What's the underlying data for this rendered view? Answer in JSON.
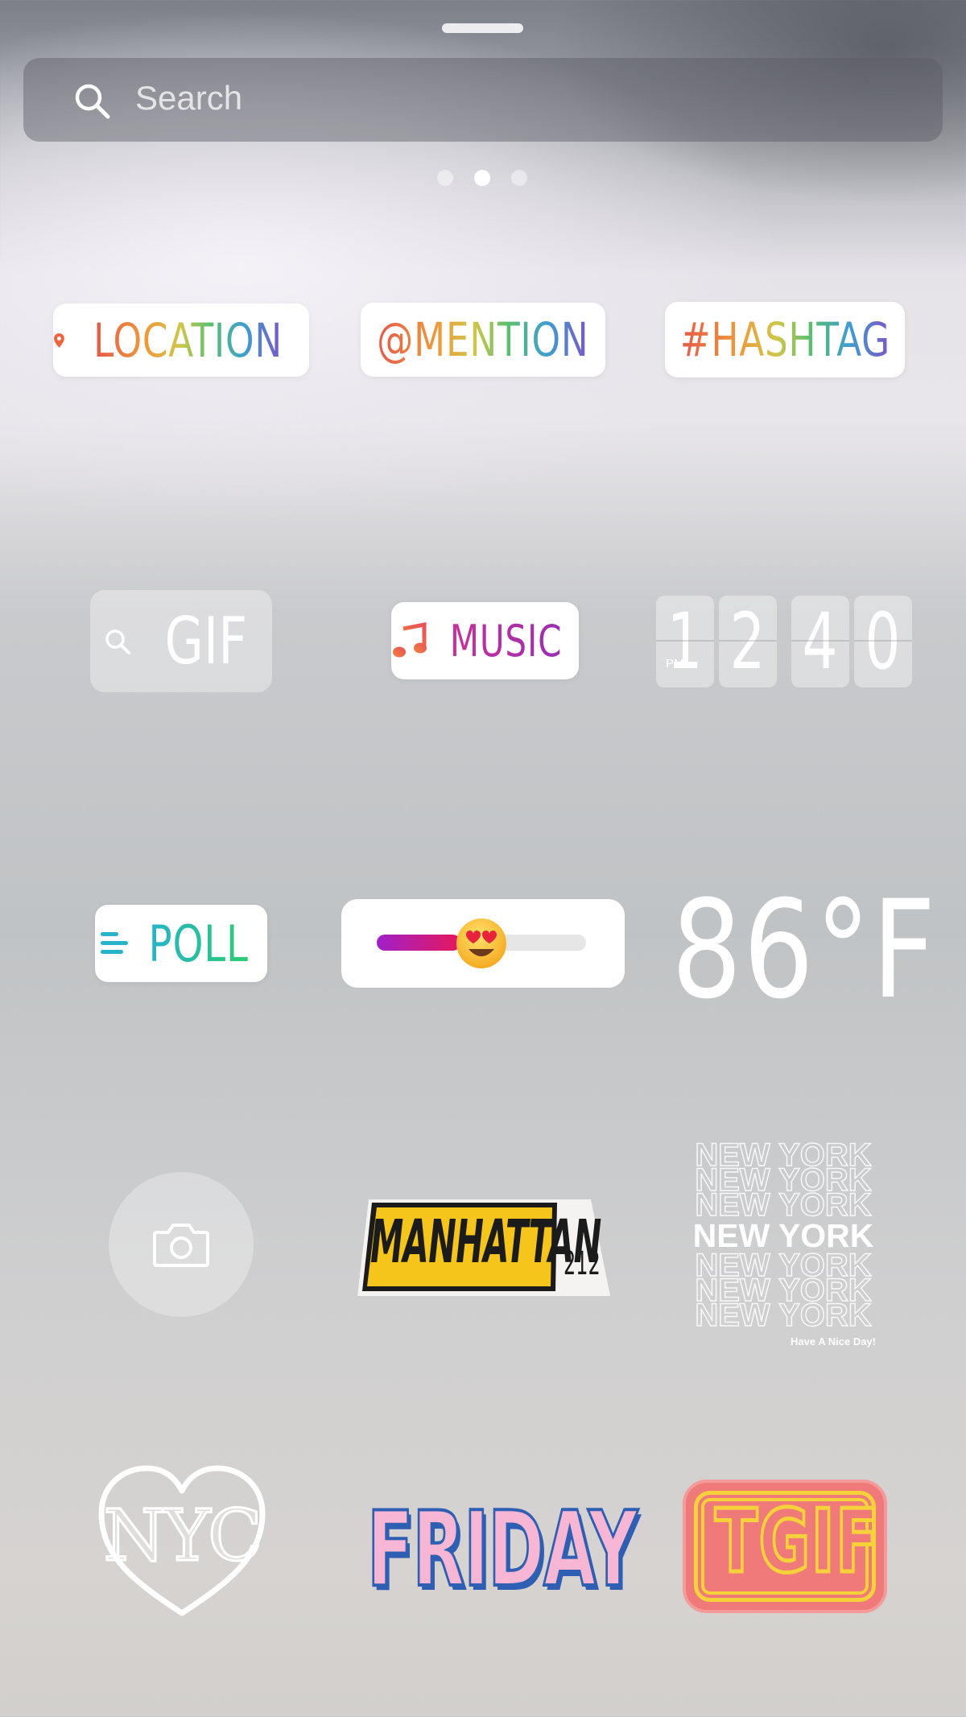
{
  "header": {
    "search_placeholder": "Search",
    "page_indicator": {
      "current": 2,
      "total": 3
    }
  },
  "stickers": {
    "location": {
      "label": "LOCATION"
    },
    "mention": {
      "label": "@MENTION"
    },
    "hashtag": {
      "label": "#HASHTAG"
    },
    "gif": {
      "label": "GIF"
    },
    "music": {
      "label": "MUSIC"
    },
    "clock": {
      "meridiem": "PM",
      "digits": [
        "1",
        "2",
        "4",
        "0"
      ]
    },
    "poll": {
      "label": "POLL"
    },
    "emoji_slider": {
      "emoji": "😍",
      "level": 0.4
    },
    "temperature": {
      "label": "86°F"
    },
    "manhattan": {
      "label": "MANHATTAN",
      "area_code": "212"
    },
    "new_york": {
      "label": "NEW YORK",
      "tagline": "Have A Nice Day!"
    },
    "nyc_heart": {
      "label": "NYC"
    },
    "friday": {
      "label": "FRIDAY"
    },
    "tgif": {
      "label": "TGIF"
    }
  },
  "colors": {
    "accent_pink": "#c8309a",
    "poll_teal": "#27b3c9",
    "manhattan_yellow": "#f6c51c",
    "tgif_red": "#f07a7a"
  }
}
